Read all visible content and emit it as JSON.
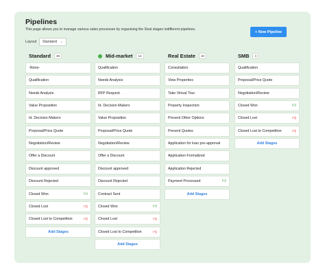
{
  "page": {
    "title": "Pipelines",
    "description": "This page allows you to manage various sales processes by organising the Deal stages indifferent pipelines.",
    "new_pipeline_label": "+ New Pipeline",
    "layout_label": "Layout",
    "layout_value": "Standard",
    "add_stages_label": "Add Stages"
  },
  "columns": [
    {
      "name": "Standard",
      "count": "36",
      "active": false,
      "stages": [
        {
          "label": "-None-"
        },
        {
          "label": "Qualification"
        },
        {
          "label": "Needs Analysis"
        },
        {
          "label": "Value Proposition"
        },
        {
          "label": "Id. Decision Makers"
        },
        {
          "label": "Proposal/Price Quote"
        },
        {
          "label": "Negotiation/Review"
        },
        {
          "label": "Offer a Discount"
        },
        {
          "label": "Discount approved"
        },
        {
          "label": "Discount Rejected"
        },
        {
          "label": "Closed Won",
          "icon": "thumbs-up-icon"
        },
        {
          "label": "Closed Lost",
          "icon": "thumbs-down-icon"
        },
        {
          "label": "Closed Lost to Competition",
          "icon": "thumbs-down-icon"
        }
      ]
    },
    {
      "name": "Mid-market",
      "count": "14",
      "active": true,
      "stages": [
        {
          "label": "Qualification"
        },
        {
          "label": "Needs Analysis"
        },
        {
          "label": "RFP Request"
        },
        {
          "label": "Id. Decision Makers"
        },
        {
          "label": "Value Proposition"
        },
        {
          "label": "Proposal/Price Quote"
        },
        {
          "label": "Negotiation/Review"
        },
        {
          "label": "Offer a Discount"
        },
        {
          "label": "Discount approved"
        },
        {
          "label": "Discount Rejected"
        },
        {
          "label": "Contract Sent"
        },
        {
          "label": "Closed Won",
          "icon": "thumbs-up-icon"
        },
        {
          "label": "Closed Lost",
          "icon": "thumbs-down-icon"
        },
        {
          "label": "Closed Lost to Competition",
          "icon": "thumbs-down-icon"
        }
      ]
    },
    {
      "name": "Real Estate",
      "count": "10",
      "active": false,
      "stages": [
        {
          "label": "Consultation"
        },
        {
          "label": "View Properties"
        },
        {
          "label": "Take Virtual Tour"
        },
        {
          "label": "Property Inspection"
        },
        {
          "label": "Present Other Options"
        },
        {
          "label": "Present Quotes"
        },
        {
          "label": "Application for loan pre-approval"
        },
        {
          "label": "Application Formalized"
        },
        {
          "label": "Application Rejected"
        },
        {
          "label": "Payment Processed",
          "icon": "thumbs-up-icon"
        }
      ]
    },
    {
      "name": "SMB",
      "count": "4",
      "active": false,
      "stages": [
        {
          "label": "Qualification"
        },
        {
          "label": "Proposal/Price Quote"
        },
        {
          "label": "Negotiation/Review"
        },
        {
          "label": "Closed Won",
          "icon": "thumbs-up-icon"
        },
        {
          "label": "Closed Lost",
          "icon": "thumbs-down-icon"
        },
        {
          "label": "Closed Lost to Competition",
          "icon": "thumbs-down-icon"
        }
      ]
    }
  ]
}
